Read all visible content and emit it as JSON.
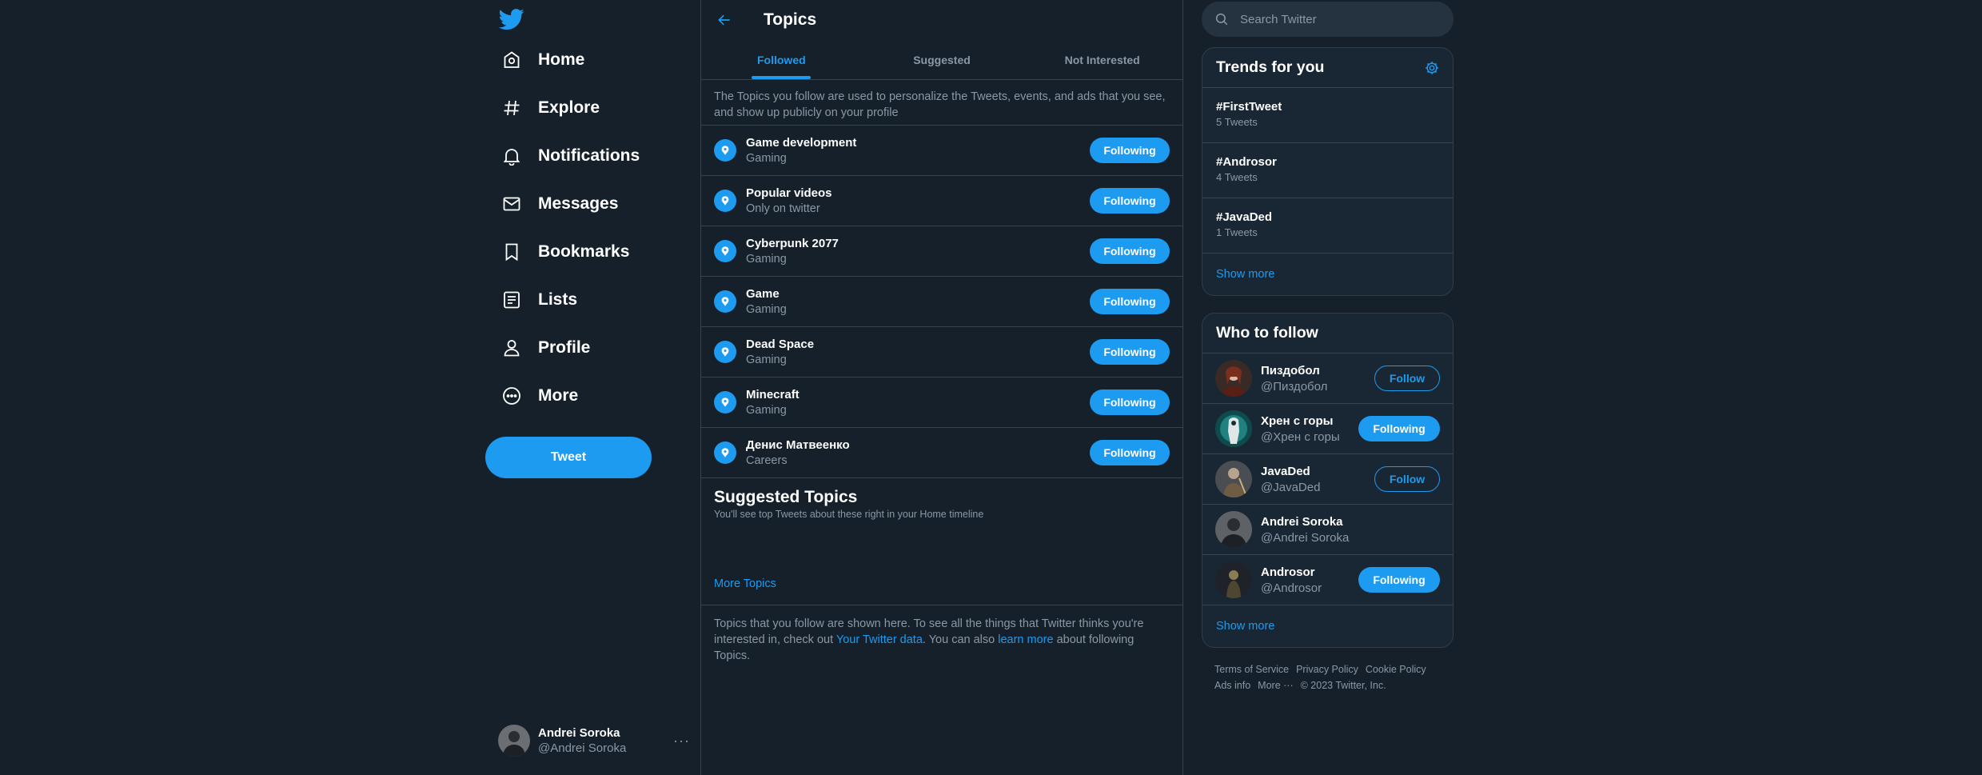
{
  "nav": {
    "items": [
      {
        "label": "Home",
        "icon": "home-icon"
      },
      {
        "label": "Explore",
        "icon": "hashtag-icon"
      },
      {
        "label": "Notifications",
        "icon": "bell-icon"
      },
      {
        "label": "Messages",
        "icon": "envelope-icon"
      },
      {
        "label": "Bookmarks",
        "icon": "bookmark-icon"
      },
      {
        "label": "Lists",
        "icon": "list-icon"
      },
      {
        "label": "Profile",
        "icon": "person-icon"
      },
      {
        "label": "More",
        "icon": "more-circle-icon"
      }
    ],
    "tweet_label": "Tweet",
    "account": {
      "name": "Andrei Soroka",
      "handle": "@Andrei Soroka",
      "more": "···"
    }
  },
  "center": {
    "title": "Topics",
    "tabs": [
      {
        "label": "Followed",
        "active": true
      },
      {
        "label": "Suggested",
        "active": false
      },
      {
        "label": "Not Interested",
        "active": false
      }
    ],
    "intro": "The Topics you follow are used to personalize the Tweets, events, and ads that you see, and show up publicly on your profile",
    "topics": [
      {
        "name": "Game development",
        "category": "Gaming",
        "button": "Following"
      },
      {
        "name": "Popular videos",
        "category": "Only on twitter",
        "button": "Following"
      },
      {
        "name": "Cyberpunk 2077",
        "category": "Gaming",
        "button": "Following"
      },
      {
        "name": "Game",
        "category": "Gaming",
        "button": "Following"
      },
      {
        "name": "Dead Space",
        "category": "Gaming",
        "button": "Following"
      },
      {
        "name": "Minecraft",
        "category": "Gaming",
        "button": "Following"
      },
      {
        "name": "Денис Матвеенко",
        "category": "Careers",
        "button": "Following"
      }
    ],
    "suggested": {
      "title": "Suggested Topics",
      "subtitle": "You'll see top Tweets about these right in your Home timeline",
      "more_link": "More Topics"
    },
    "footer": {
      "part1": "Topics that you follow are shown here. To see all the things that Twitter thinks you're interested in, check out ",
      "link1": "Your Twitter data",
      "part2": ". You can also ",
      "link2": "learn more",
      "part3": " about following Topics."
    }
  },
  "right": {
    "search_placeholder": "Search Twitter",
    "trends": {
      "title": "Trends for you",
      "items": [
        {
          "tag": "#FirstTweet",
          "count": "5 Tweets"
        },
        {
          "tag": "#Androsor",
          "count": "4 Tweets"
        },
        {
          "tag": "#JavaDed",
          "count": "1 Tweets"
        }
      ],
      "show_more": "Show more"
    },
    "who_to_follow": {
      "title": "Who to follow",
      "users": [
        {
          "name": "Пиздобол",
          "handle": "@Пиздобол",
          "button": "Follow",
          "following": false
        },
        {
          "name": "Хрен с горы",
          "handle": "@Хрен с горы",
          "button": "Following",
          "following": true
        },
        {
          "name": "JavaDed",
          "handle": "@JavaDed",
          "button": "Follow",
          "following": false
        },
        {
          "name": "Andrei Soroka",
          "handle": "@Andrei Soroka",
          "button": "",
          "following": false
        },
        {
          "name": "Androsor",
          "handle": "@Androsor",
          "button": "Following",
          "following": true
        }
      ],
      "show_more": "Show more"
    },
    "legal": [
      "Terms of Service",
      "Privacy Policy",
      "Cookie Policy",
      "Ads info",
      "More ···",
      "© 2023 Twitter, Inc."
    ]
  },
  "colors": {
    "background": "#15202b",
    "panel": "#192734",
    "accent": "#1d9bf0",
    "muted": "#8b98a5",
    "border": "#38444d"
  }
}
